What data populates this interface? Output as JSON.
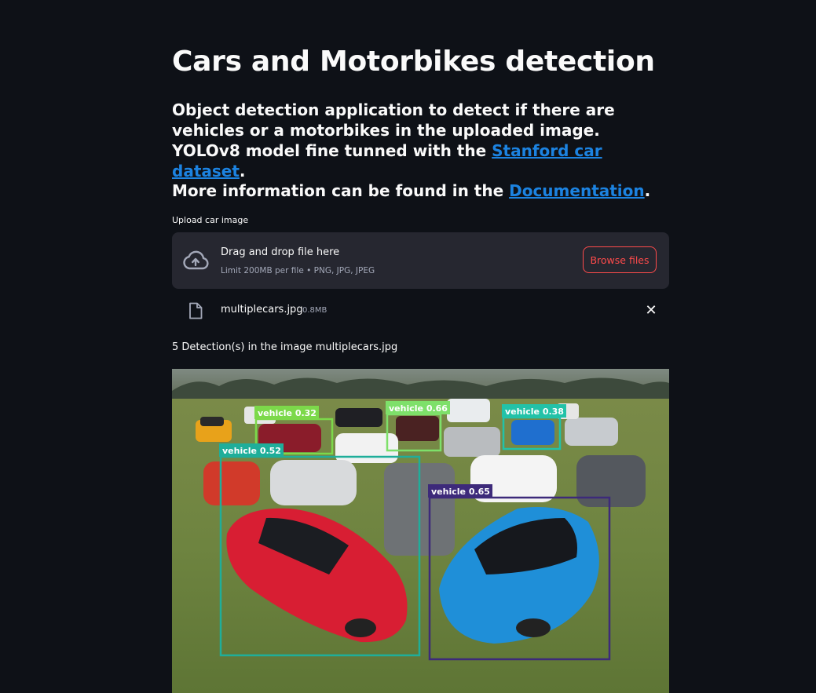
{
  "page": {
    "title": "Cars and Motorbikes detection",
    "description_prefix": "Object detection application to detect if there are vehicles or a motorbikes in the uploaded image. YOLOv8 model fine tunned with the ",
    "description_link": "Stanford car dataset",
    "description_suffix": ".",
    "more_prefix": "More information can be found in the ",
    "more_link": "Documentation",
    "more_suffix": "."
  },
  "uploader": {
    "label": "Upload car image",
    "drop_text": "Drag and drop file here",
    "limit_text": "Limit 200MB per file • PNG, JPG, JPEG",
    "browse_label": "Browse files",
    "file_name": "multiplecars.jpg",
    "file_size": "0.8MB"
  },
  "result": {
    "summary": "5 Detection(s) in the image multiplecars.jpg",
    "detections": [
      {
        "label": "vehicle 0.32",
        "color": "#7cd94a"
      },
      {
        "label": "vehicle 0.66",
        "color": "#7ee06a"
      },
      {
        "label": "vehicle 0.38",
        "color": "#22c2a8"
      },
      {
        "label": "vehicle 0.52",
        "color": "#1fae9a"
      },
      {
        "label": "vehicle 0.65",
        "color": "#3d2a7a"
      }
    ]
  },
  "theme": {
    "background": "#0e1117",
    "link": "#1c83e1",
    "accent": "#ff4b4b",
    "dropzone": "#262730"
  },
  "icons": {
    "upload": "cloud-upload-icon",
    "file": "file-icon",
    "remove": "close-icon"
  }
}
